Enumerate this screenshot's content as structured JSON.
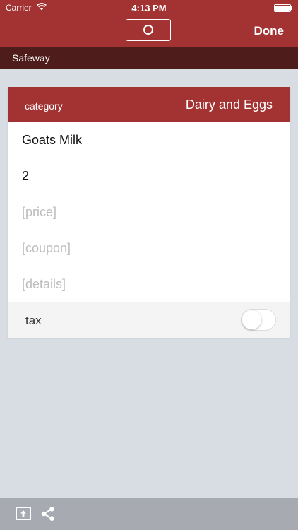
{
  "status_bar": {
    "carrier": "Carrier",
    "time": "4:13 PM"
  },
  "nav": {
    "done_label": "Done"
  },
  "store": {
    "name": "Safeway"
  },
  "item": {
    "category_label": "category",
    "category_value": "Dairy and Eggs",
    "name": "Goats Milk",
    "quantity": "2",
    "price_placeholder": "[price]",
    "coupon_placeholder": "[coupon]",
    "details_placeholder": "[details]",
    "tax_label": "tax",
    "tax_enabled": false
  },
  "icons": {
    "center_button": "circle-icon",
    "bottom_left": "upload-icon",
    "bottom_right": "share-icon"
  },
  "colors": {
    "primary": "#a33232",
    "store_bar": "#4f1c1c",
    "background": "#d8dce3",
    "bottom_bar": "#a7aab0"
  }
}
